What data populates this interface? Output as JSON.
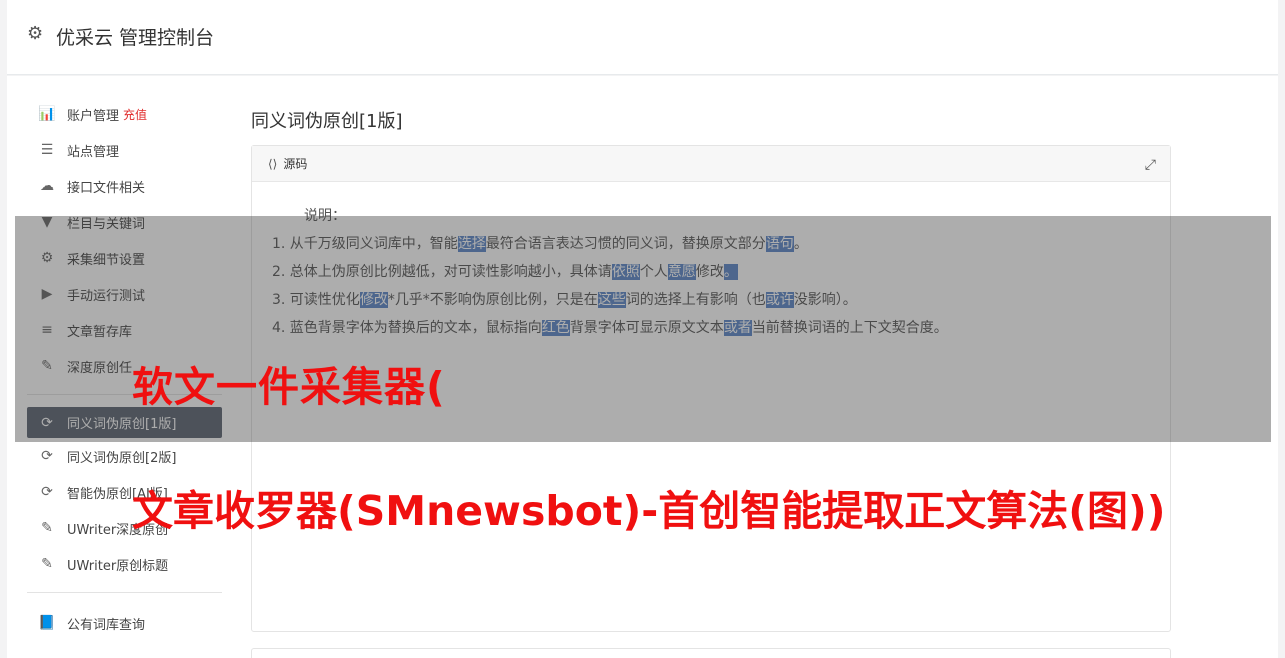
{
  "header": {
    "gear_icon": "gear-icon",
    "brand": "优采云 管理控制台"
  },
  "sidebar": {
    "items": [
      {
        "icon": "bar-chart-icon",
        "glyph": "📊",
        "label": "账户管理",
        "badge": "充值"
      },
      {
        "icon": "server-icon",
        "glyph": "☰",
        "label": "站点管理"
      },
      {
        "icon": "cloud-upload-icon",
        "glyph": "☁",
        "label": "接口文件相关"
      },
      {
        "icon": "filter-icon",
        "glyph": "▼",
        "label": "栏目与关键词"
      },
      {
        "icon": "cogs-icon",
        "glyph": "⚙",
        "label": "采集细节设置"
      },
      {
        "icon": "play-icon",
        "glyph": "▶",
        "label": "手动运行测试"
      },
      {
        "icon": "database-icon",
        "glyph": "≡",
        "label": "文章暂存库"
      },
      {
        "icon": "edit-icon",
        "glyph": "✎",
        "label": "深度原创任"
      }
    ],
    "items2": [
      {
        "icon": "refresh-icon",
        "glyph": "⟳",
        "label": "同义词伪原创[1版]",
        "active": true
      },
      {
        "icon": "refresh-icon",
        "glyph": "⟳",
        "label": "同义词伪原创[2版]"
      },
      {
        "icon": "refresh-icon",
        "glyph": "⟳",
        "label": "智能伪原创[AI版]"
      },
      {
        "icon": "edit-icon",
        "glyph": "✎",
        "label": "UWriter深度原创"
      },
      {
        "icon": "edit-icon",
        "glyph": "✎",
        "label": "UWriter原创标题"
      }
    ],
    "items3": [
      {
        "icon": "book-icon",
        "glyph": "📘",
        "label": "公有词库查询"
      }
    ]
  },
  "main": {
    "title": "同义词伪原创[1版]",
    "box_header": "源码",
    "notes_lead": "说明：",
    "notes": [
      {
        "parts": [
          "1. 从千万级同义词库中，智能",
          "选择",
          "最符合语言表达习惯的同义词，替换原文部分",
          "语句",
          "。"
        ]
      },
      {
        "parts": [
          "2. 总体上伪原创比例越低，对可读性影响越小，具体请",
          "依照",
          "个人",
          "意愿",
          "修改",
          "。"
        ]
      },
      {
        "parts": [
          "3. 可读性优化",
          "修改",
          "*几乎*不影响伪原创比例，只是在",
          "这些",
          "词的选择上有影响（也",
          "或许",
          "没影响）。"
        ]
      },
      {
        "parts": [
          "4. 蓝色背景字体为替换后的文本，鼠标指向",
          "红色",
          "背景字体可显示原文文本",
          "或者",
          "当前替换词语的上下文契合度。"
        ]
      }
    ]
  },
  "overlay": {
    "line1": "软文一件采集器(",
    "line2": "文章收罗器(SMnewsbot)-首创智能提取正文算法(图))"
  }
}
